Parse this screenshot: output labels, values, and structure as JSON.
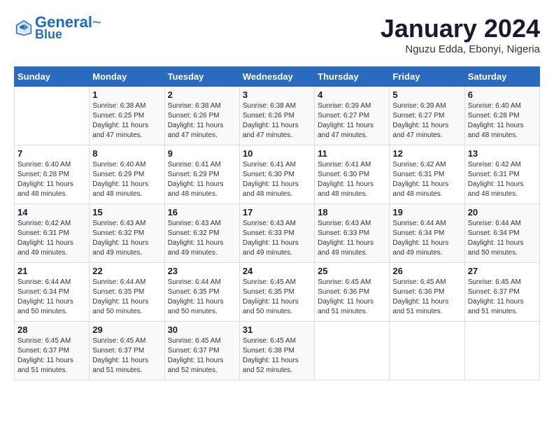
{
  "header": {
    "logo_line1": "General",
    "logo_line2": "Blue",
    "month_title": "January 2024",
    "location": "Nguzu Edda, Ebonyi, Nigeria"
  },
  "days_of_week": [
    "Sunday",
    "Monday",
    "Tuesday",
    "Wednesday",
    "Thursday",
    "Friday",
    "Saturday"
  ],
  "weeks": [
    [
      {
        "day": "",
        "info": ""
      },
      {
        "day": "1",
        "info": "Sunrise: 6:38 AM\nSunset: 6:25 PM\nDaylight: 11 hours\nand 47 minutes."
      },
      {
        "day": "2",
        "info": "Sunrise: 6:38 AM\nSunset: 6:26 PM\nDaylight: 11 hours\nand 47 minutes."
      },
      {
        "day": "3",
        "info": "Sunrise: 6:38 AM\nSunset: 6:26 PM\nDaylight: 11 hours\nand 47 minutes."
      },
      {
        "day": "4",
        "info": "Sunrise: 6:39 AM\nSunset: 6:27 PM\nDaylight: 11 hours\nand 47 minutes."
      },
      {
        "day": "5",
        "info": "Sunrise: 6:39 AM\nSunset: 6:27 PM\nDaylight: 11 hours\nand 47 minutes."
      },
      {
        "day": "6",
        "info": "Sunrise: 6:40 AM\nSunset: 6:28 PM\nDaylight: 11 hours\nand 48 minutes."
      }
    ],
    [
      {
        "day": "7",
        "info": "Sunrise: 6:40 AM\nSunset: 6:28 PM\nDaylight: 11 hours\nand 48 minutes."
      },
      {
        "day": "8",
        "info": "Sunrise: 6:40 AM\nSunset: 6:29 PM\nDaylight: 11 hours\nand 48 minutes."
      },
      {
        "day": "9",
        "info": "Sunrise: 6:41 AM\nSunset: 6:29 PM\nDaylight: 11 hours\nand 48 minutes."
      },
      {
        "day": "10",
        "info": "Sunrise: 6:41 AM\nSunset: 6:30 PM\nDaylight: 11 hours\nand 48 minutes."
      },
      {
        "day": "11",
        "info": "Sunrise: 6:41 AM\nSunset: 6:30 PM\nDaylight: 11 hours\nand 48 minutes."
      },
      {
        "day": "12",
        "info": "Sunrise: 6:42 AM\nSunset: 6:31 PM\nDaylight: 11 hours\nand 48 minutes."
      },
      {
        "day": "13",
        "info": "Sunrise: 6:42 AM\nSunset: 6:31 PM\nDaylight: 11 hours\nand 48 minutes."
      }
    ],
    [
      {
        "day": "14",
        "info": "Sunrise: 6:42 AM\nSunset: 6:31 PM\nDaylight: 11 hours\nand 49 minutes."
      },
      {
        "day": "15",
        "info": "Sunrise: 6:43 AM\nSunset: 6:32 PM\nDaylight: 11 hours\nand 49 minutes."
      },
      {
        "day": "16",
        "info": "Sunrise: 6:43 AM\nSunset: 6:32 PM\nDaylight: 11 hours\nand 49 minutes."
      },
      {
        "day": "17",
        "info": "Sunrise: 6:43 AM\nSunset: 6:33 PM\nDaylight: 11 hours\nand 49 minutes."
      },
      {
        "day": "18",
        "info": "Sunrise: 6:43 AM\nSunset: 6:33 PM\nDaylight: 11 hours\nand 49 minutes."
      },
      {
        "day": "19",
        "info": "Sunrise: 6:44 AM\nSunset: 6:34 PM\nDaylight: 11 hours\nand 49 minutes."
      },
      {
        "day": "20",
        "info": "Sunrise: 6:44 AM\nSunset: 6:34 PM\nDaylight: 11 hours\nand 50 minutes."
      }
    ],
    [
      {
        "day": "21",
        "info": "Sunrise: 6:44 AM\nSunset: 6:34 PM\nDaylight: 11 hours\nand 50 minutes."
      },
      {
        "day": "22",
        "info": "Sunrise: 6:44 AM\nSunset: 6:35 PM\nDaylight: 11 hours\nand 50 minutes."
      },
      {
        "day": "23",
        "info": "Sunrise: 6:44 AM\nSunset: 6:35 PM\nDaylight: 11 hours\nand 50 minutes."
      },
      {
        "day": "24",
        "info": "Sunrise: 6:45 AM\nSunset: 6:35 PM\nDaylight: 11 hours\nand 50 minutes."
      },
      {
        "day": "25",
        "info": "Sunrise: 6:45 AM\nSunset: 6:36 PM\nDaylight: 11 hours\nand 51 minutes."
      },
      {
        "day": "26",
        "info": "Sunrise: 6:45 AM\nSunset: 6:36 PM\nDaylight: 11 hours\nand 51 minutes."
      },
      {
        "day": "27",
        "info": "Sunrise: 6:45 AM\nSunset: 6:37 PM\nDaylight: 11 hours\nand 51 minutes."
      }
    ],
    [
      {
        "day": "28",
        "info": "Sunrise: 6:45 AM\nSunset: 6:37 PM\nDaylight: 11 hours\nand 51 minutes."
      },
      {
        "day": "29",
        "info": "Sunrise: 6:45 AM\nSunset: 6:37 PM\nDaylight: 11 hours\nand 51 minutes."
      },
      {
        "day": "30",
        "info": "Sunrise: 6:45 AM\nSunset: 6:37 PM\nDaylight: 11 hours\nand 52 minutes."
      },
      {
        "day": "31",
        "info": "Sunrise: 6:45 AM\nSunset: 6:38 PM\nDaylight: 11 hours\nand 52 minutes."
      },
      {
        "day": "",
        "info": ""
      },
      {
        "day": "",
        "info": ""
      },
      {
        "day": "",
        "info": ""
      }
    ]
  ]
}
